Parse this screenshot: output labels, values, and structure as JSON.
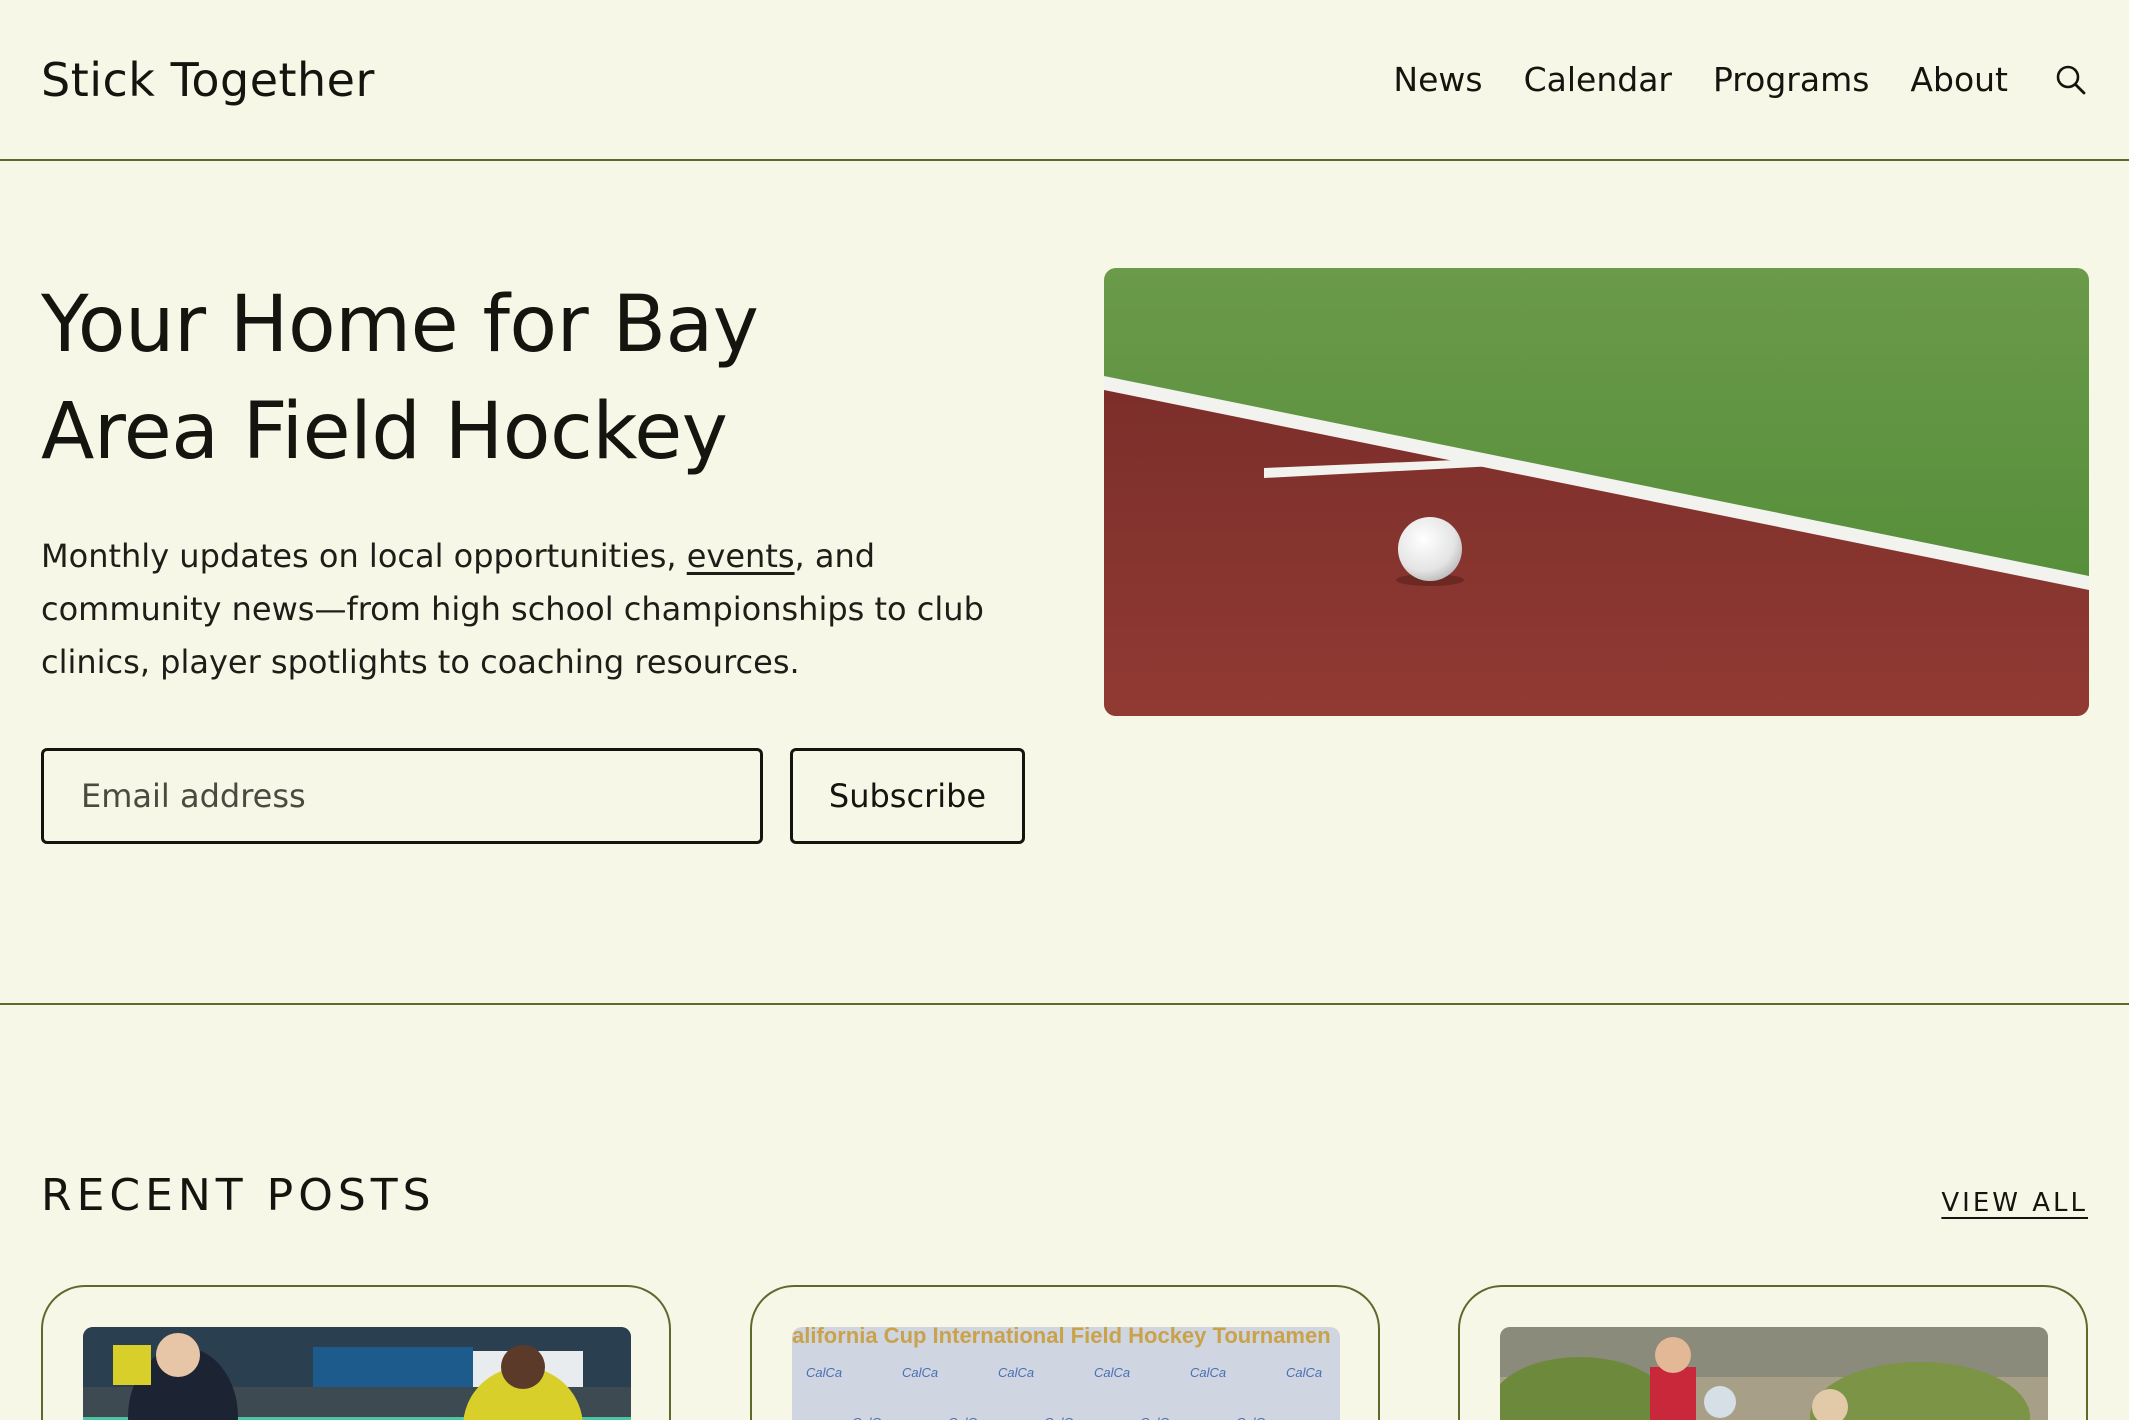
{
  "header": {
    "site_title": "Stick Together",
    "nav": [
      "News",
      "Calendar",
      "Programs",
      "About"
    ],
    "search_icon": "search-icon"
  },
  "hero": {
    "title_line1": "Your Home for Bay",
    "title_line2": "Area Field Hockey",
    "desc_before": "Monthly updates on local opportunities, ",
    "desc_link": "events",
    "desc_after": ", and community news—from high school championships to club clinics, player spotlights to coaching resources.",
    "email_placeholder": "Email address",
    "subscribe_label": "Subscribe",
    "image_alt": "White field hockey ball on red turf beside green pitch"
  },
  "recent": {
    "heading": "RECENT POSTS",
    "view_all": "VIEW ALL",
    "posts": [
      {
        "image": "Players competing in a field hockey match"
      },
      {
        "image": "California Cup International Field Hockey Tournament banner",
        "banner_text": "alifornia Cup International Field Hockey Tournamen"
      },
      {
        "image": "Young players at a field hockey clinic"
      }
    ]
  },
  "colors": {
    "background": "#f7f7e8",
    "text": "#15150f",
    "divider": "#5c6a2c"
  }
}
